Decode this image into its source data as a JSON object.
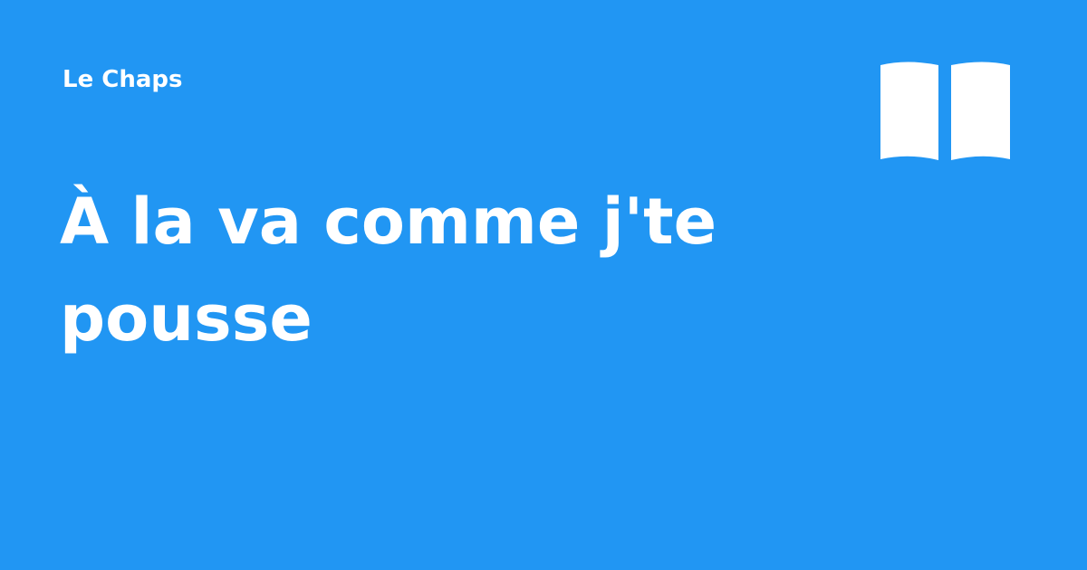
{
  "theme": {
    "background_color": "#2196f3",
    "text_color": "#ffffff"
  },
  "header": {
    "site_name": "Le Chaps",
    "icon": "open-book-icon"
  },
  "main": {
    "title": "À la va comme j'te pousse"
  }
}
